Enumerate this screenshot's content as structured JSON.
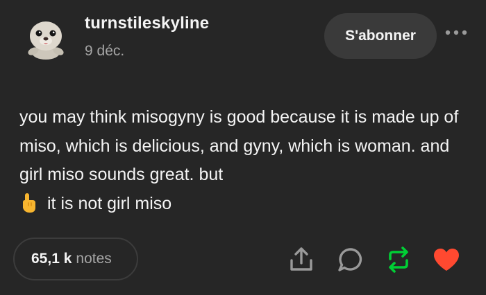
{
  "post": {
    "username": "turnstileskyline",
    "date": "9 déc.",
    "follow_label": "S'abonner",
    "body_text": "you may think misogyny is good because it is made up of miso, which is delicious, and gyny, which is woman. and girl miso sounds great. but",
    "body_last_line": "it is not girl miso",
    "notes_count": "65,1 k",
    "notes_label": "notes"
  },
  "icons": {
    "avatar": "seal-plush-avatar",
    "more": "more-horizontal-icon",
    "point": "pointing-up-emoji-icon",
    "share": "share-icon",
    "reply": "reply-bubble-icon",
    "reblog": "reblog-icon",
    "like": "heart-icon"
  },
  "colors": {
    "background": "#262626",
    "reblog": "#00cf35",
    "like": "#ff4930"
  }
}
